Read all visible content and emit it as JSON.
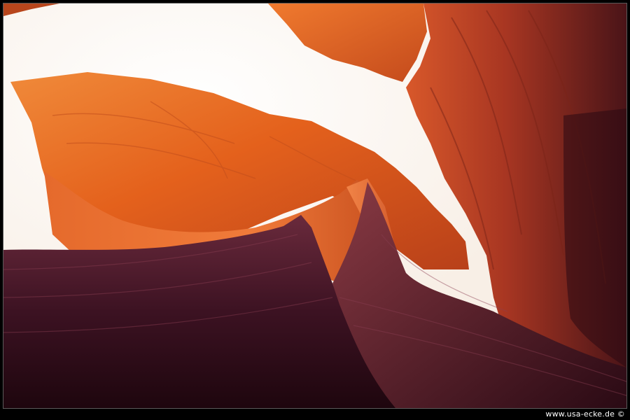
{
  "credit": {
    "text": "www.usa-ecke.de ©"
  },
  "colors": {
    "sky": "#fdfbf8",
    "rock_orange": "#e8631d",
    "rock_red": "#a9381c",
    "shadow_purple": "#3b1020"
  }
}
